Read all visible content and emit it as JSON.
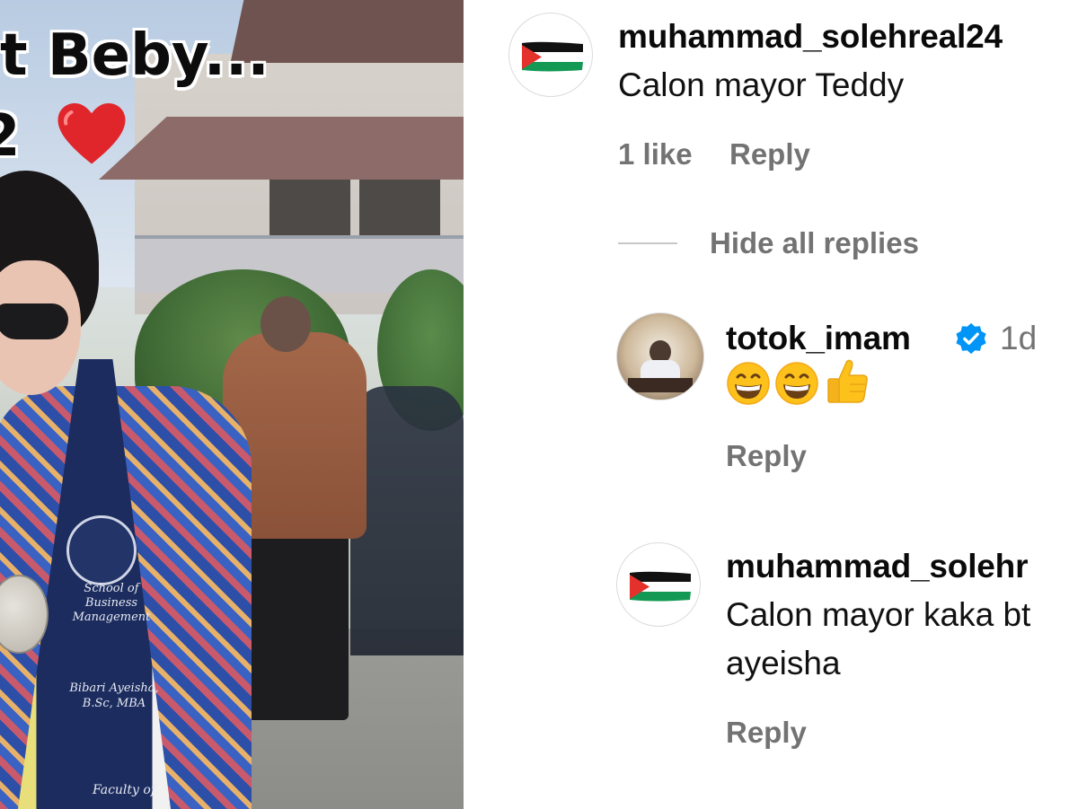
{
  "photo": {
    "caption_line1": "t Beby...",
    "caption_line2": "2",
    "stole_text1": "School of Business Management",
    "stole_text2": "Bibari Ayeisha, B.Sc, MBA",
    "stole_text3": "Faculty of"
  },
  "comments": [
    {
      "username": "muhammad_solehreal24",
      "avatar": "palestine-flag-icon",
      "text": "Calon mayor Teddy",
      "likes": "1 like",
      "reply_label": "Reply",
      "toggle_replies": "Hide all replies"
    }
  ],
  "replies": [
    {
      "username": "totok_imam",
      "verified": true,
      "time": "1d",
      "text_emojis": [
        "grinning-face-icon",
        "grinning-face-icon",
        "thumbs-up-icon"
      ],
      "reply_label": "Reply"
    },
    {
      "username": "muhammad_solehr",
      "avatar": "palestine-flag-icon",
      "text_line1": "Calon mayor kaka bt",
      "text_line2": "ayeisha",
      "reply_label": "Reply"
    }
  ],
  "colors": {
    "secondary_text": "#737373",
    "verified_blue": "#0095f6",
    "flag_red": "#e4312b",
    "flag_green": "#149954"
  }
}
